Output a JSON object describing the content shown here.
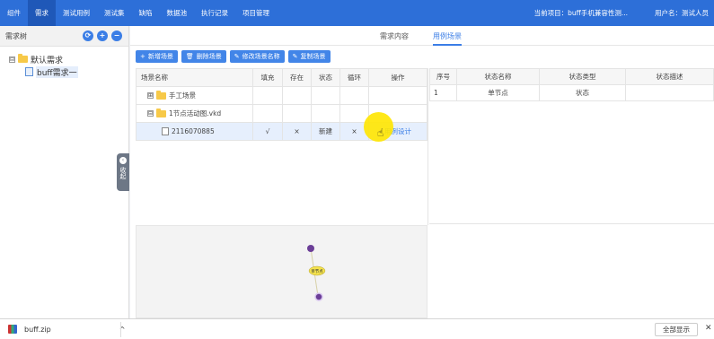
{
  "topbar": {
    "nav": [
      "组件",
      "需求",
      "测试用例",
      "测试集",
      "缺陷",
      "数据池",
      "执行记录",
      "项目管理"
    ],
    "active_nav": "需求",
    "project": "当前项目：buff手机兼容性测...",
    "user": "用户名：测试人员"
  },
  "sidebar": {
    "title": "需求树",
    "tools": [
      "⟳",
      "+",
      "−"
    ],
    "tree": {
      "root": {
        "expander": "⊟",
        "label": "默认需求"
      },
      "child": {
        "label": "buff需求一"
      }
    }
  },
  "collapse_handle": {
    "label": "收起"
  },
  "tabs": [
    "需求内容",
    "用例场景"
  ],
  "active_tab": "用例场景",
  "toolbar": [
    {
      "icon": "+",
      "label": "新增场景"
    },
    {
      "icon": "🗑",
      "label": "删除场景"
    },
    {
      "icon": "✎",
      "label": "修改场景名称"
    },
    {
      "icon": "✎",
      "label": "复制场景"
    }
  ],
  "scene_table": {
    "headers": [
      "场景名称",
      "填充",
      "存在",
      "状态",
      "循环",
      "操作"
    ],
    "rows": [
      {
        "expander": "⊞",
        "name": "手工场景",
        "fill": "",
        "exist": "",
        "status": "",
        "loop": "",
        "action": ""
      },
      {
        "expander": "⊟",
        "name": "1节点活动图.vkd",
        "fill": "",
        "exist": "",
        "status": "",
        "loop": "",
        "action": ""
      },
      {
        "expander": "",
        "name": "2116070885",
        "fill": "√",
        "exist": "×",
        "status": "新建",
        "loop": "×",
        "action": "用例设计"
      }
    ]
  },
  "state_table": {
    "headers": [
      "序号",
      "状态名称",
      "状态类型",
      "状态描述"
    ],
    "rows": [
      {
        "index": "1",
        "name": "单节点",
        "type": "状态",
        "desc": ""
      }
    ]
  },
  "diagram": {
    "node_label": "单节点"
  },
  "download_bar": {
    "file": "buff.zip",
    "chevron": "^",
    "show_all": "全部显示",
    "close": "✕"
  }
}
